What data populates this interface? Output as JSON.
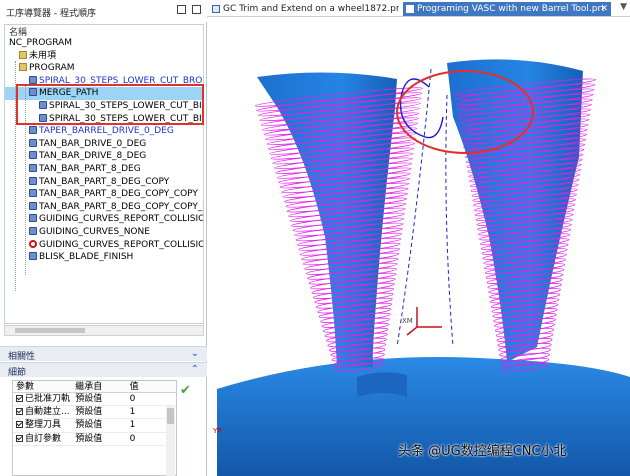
{
  "navigator": {
    "title": "工序導覽器 - 程式順序",
    "column_name": "名稱",
    "items": [
      {
        "label": "NC_PROGRAM",
        "indent": 0,
        "icon": "none",
        "style": "normal"
      },
      {
        "label": "未用項",
        "indent": 1,
        "icon": "folder",
        "style": "normal"
      },
      {
        "label": "PROGRAM",
        "indent": 1,
        "icon": "folder",
        "style": "normal"
      },
      {
        "label": "SPIRAL_30_STEPS_LOWER_CUT_BRO",
        "indent": 2,
        "icon": "op",
        "style": "blue"
      },
      {
        "label": "MERGE_PATH",
        "indent": 2,
        "icon": "op",
        "style": "selected"
      },
      {
        "label": "SPIRAL_30_STEPS_LOWER_CUT_BI",
        "indent": 3,
        "icon": "op",
        "style": "normal"
      },
      {
        "label": "SPIRAL_30_STEPS_LOWER_CUT_BI",
        "indent": 3,
        "icon": "op",
        "style": "normal"
      },
      {
        "label": "TAPER_BARREL_DRIVE_0_DEG",
        "indent": 2,
        "icon": "op",
        "style": "blue"
      },
      {
        "label": "TAN_BAR_DRIVE_0_DEG",
        "indent": 2,
        "icon": "op",
        "style": "normal"
      },
      {
        "label": "TAN_BAR_DRIVE_8_DEG",
        "indent": 2,
        "icon": "op",
        "style": "normal"
      },
      {
        "label": "TAN_BAR_PART_8_DEG",
        "indent": 2,
        "icon": "op",
        "style": "normal"
      },
      {
        "label": "TAN_BAR_PART_8_DEG_COPY",
        "indent": 2,
        "icon": "op",
        "style": "normal"
      },
      {
        "label": "TAN_BAR_PART_8_DEG_COPY_COPY",
        "indent": 2,
        "icon": "op",
        "style": "normal"
      },
      {
        "label": "TAN_BAR_PART_8_DEG_COPY_COPY_CO",
        "indent": 2,
        "icon": "op",
        "style": "normal"
      },
      {
        "label": "GUIDING_CURVES_REPORT_COLLISION",
        "indent": 2,
        "icon": "op",
        "style": "normal"
      },
      {
        "label": "GUIDING_CURVES_NONE",
        "indent": 2,
        "icon": "op",
        "style": "normal"
      },
      {
        "label": "GUIDING_CURVES_REPORT_COLLISION",
        "indent": 2,
        "icon": "prohibit",
        "style": "normal"
      },
      {
        "label": "BLISK_BLADE_FINISH",
        "indent": 2,
        "icon": "op",
        "style": "normal"
      }
    ]
  },
  "sections": {
    "dependencies": "相關性",
    "details": "細節"
  },
  "params_table": {
    "headers": [
      "參數",
      "繼承自",
      "值"
    ],
    "rows": [
      {
        "param": "已批准刀軌",
        "from": "預設值",
        "value": "0"
      },
      {
        "param": "自動建立...",
        "from": "預設值",
        "value": "1"
      },
      {
        "param": "整理刀具",
        "from": "預設值",
        "value": "1"
      },
      {
        "param": "自訂參數",
        "from": "預設值",
        "value": "0"
      }
    ]
  },
  "tabs": [
    {
      "label": "GC Trim and Extend on a wheel1872.prt",
      "active": false
    },
    {
      "label": "Programing VASC with new Barrel Tool.prt",
      "active": true
    }
  ],
  "viewport": {
    "axis_label": "XM",
    "axis_label_2": "YP",
    "watermark": "头条 @UG数控编程CNC小北"
  },
  "colors": {
    "blade": "#1f78d1",
    "toolpath": "#e020e8",
    "highlight": "#e0322c",
    "selection": "#9bd4f4"
  }
}
